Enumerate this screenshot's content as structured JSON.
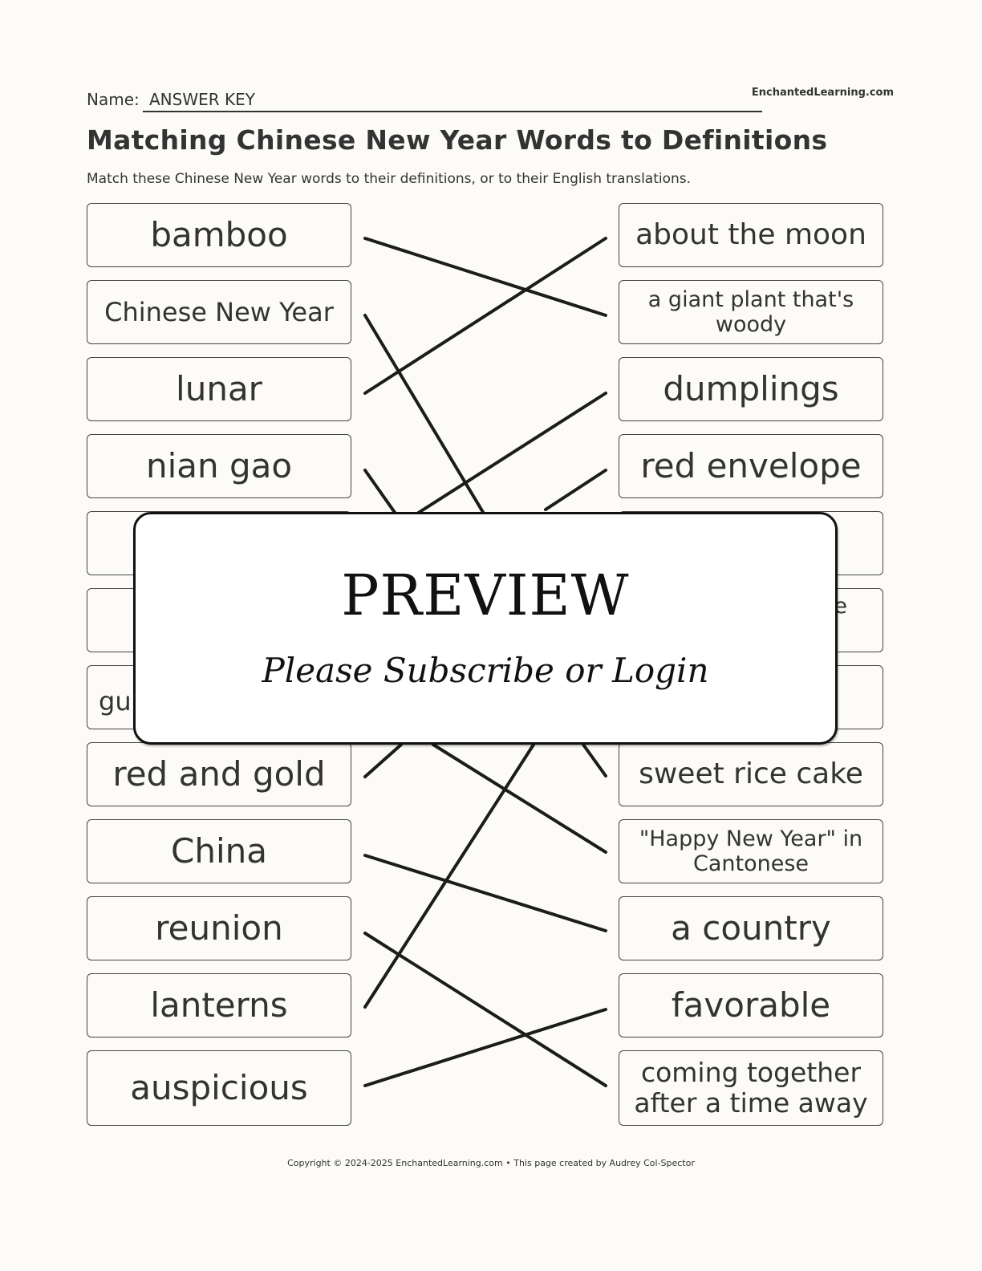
{
  "header": {
    "name_label": "Name:",
    "name_value": "ANSWER KEY",
    "site": "EnchantedLearning.com"
  },
  "title": "Matching Chinese New Year Words to Definitions",
  "instructions": "Match these Chinese New Year words to their definitions, or to their English translations.",
  "left_words": [
    {
      "text": "bamboo"
    },
    {
      "text": "Chinese New Year"
    },
    {
      "text": "lunar"
    },
    {
      "text": "nian gao"
    },
    {
      "text": ""
    },
    {
      "text": ""
    },
    {
      "text": "gu"
    },
    {
      "text": "red and gold"
    },
    {
      "text": "China"
    },
    {
      "text": "reunion"
    },
    {
      "text": "lanterns"
    },
    {
      "text": "auspicious"
    }
  ],
  "right_words": [
    {
      "text": "about the moon"
    },
    {
      "text": "a giant plant that's woody"
    },
    {
      "text": "dumplings"
    },
    {
      "text": "red envelope"
    },
    {
      "text": ""
    },
    {
      "text": "ne"
    },
    {
      "text": ""
    },
    {
      "text": "sweet rice cake"
    },
    {
      "text": "\"Happy New Year\" in Cantonese"
    },
    {
      "text": "a country"
    },
    {
      "text": "favorable"
    },
    {
      "text": "coming together after a time away"
    }
  ],
  "matches": [
    {
      "left": "bamboo",
      "right": "a giant plant that's woody"
    },
    {
      "left": "lunar",
      "right": "about the moon"
    },
    {
      "left": "nian gao",
      "right": "sweet rice cake"
    },
    {
      "left": "China",
      "right": "a country"
    },
    {
      "left": "reunion",
      "right": "coming together after a time away"
    },
    {
      "left": "auspicious",
      "right": "favorable"
    }
  ],
  "overlay": {
    "title": "PREVIEW",
    "subtitle": "Please Subscribe or Login"
  },
  "footer": "Copyright © 2024-2025 EnchantedLearning.com • This page created by Audrey Col-Spector"
}
